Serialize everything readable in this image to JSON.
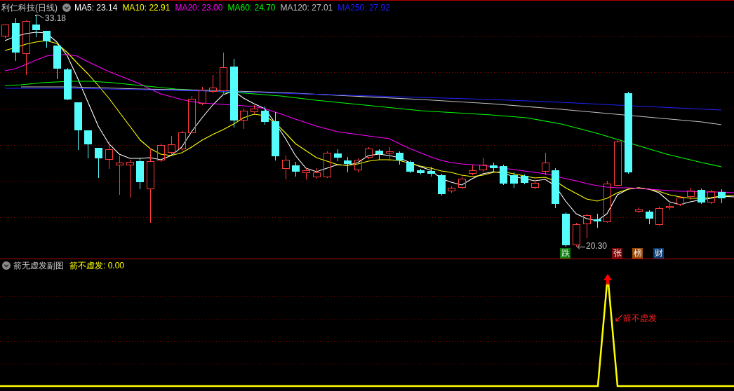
{
  "main_chart": {
    "title": "利仁科技(日线)",
    "indicators": [
      {
        "label": "MA5: 23.14",
        "color": "#ffffff"
      },
      {
        "label": "MA10: 22.91",
        "color": "#ffff00"
      },
      {
        "label": "MA20: 23.00",
        "color": "#ff00ff"
      },
      {
        "label": "MA60: 24.70",
        "color": "#00ff00"
      },
      {
        "label": "MA120: 27.01",
        "color": "#c0c0c0"
      },
      {
        "label": "MA250: 27.92",
        "color": "#2020ff"
      }
    ],
    "price_marks": [
      {
        "kind": "high",
        "text": "33.18"
      },
      {
        "kind": "low",
        "text": "20.30"
      }
    ],
    "badges": [
      {
        "text": "跌",
        "color": "#0b7d0b"
      },
      {
        "text": "张",
        "color": "#7d0a0a"
      },
      {
        "text": "榜",
        "color": "#9b4a0a"
      },
      {
        "text": "财",
        "color": "#0b3b70"
      }
    ]
  },
  "sub_chart": {
    "title": "箭无虚发副图",
    "reading": "箭不虚发: 0.00",
    "signal_label": "箭不虚发"
  }
}
